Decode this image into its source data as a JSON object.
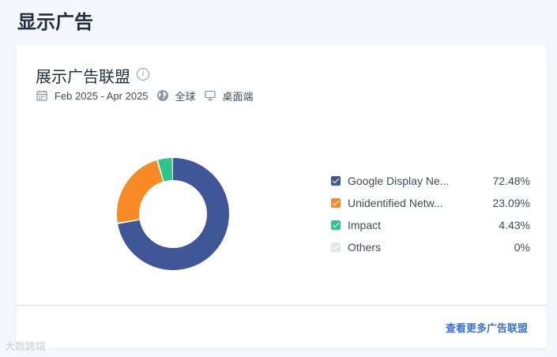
{
  "page": {
    "title": "显示广告"
  },
  "card": {
    "title": "展示广告联盟",
    "info_icon": "info-icon",
    "meta": {
      "date_range": "Feb 2025 - Apr 2025",
      "region": "全球",
      "device": "桌面端"
    },
    "more_link": "查看更多广告联盟"
  },
  "chart_data": {
    "type": "pie",
    "style": "donut",
    "legend_position": "right",
    "slices": [
      {
        "name": "Google Display Ne...",
        "value": 72.48,
        "label": "72.48%",
        "color": "#3f5796"
      },
      {
        "name": "Unidentified Netw...",
        "value": 23.09,
        "label": "23.09%",
        "color": "#f78a24"
      },
      {
        "name": "Impact",
        "value": 4.43,
        "label": "4.43%",
        "color": "#2dc48d"
      },
      {
        "name": "Others",
        "value": 0,
        "label": "0%",
        "color": "#e3e7ec"
      }
    ]
  },
  "watermark": "大数跨境"
}
